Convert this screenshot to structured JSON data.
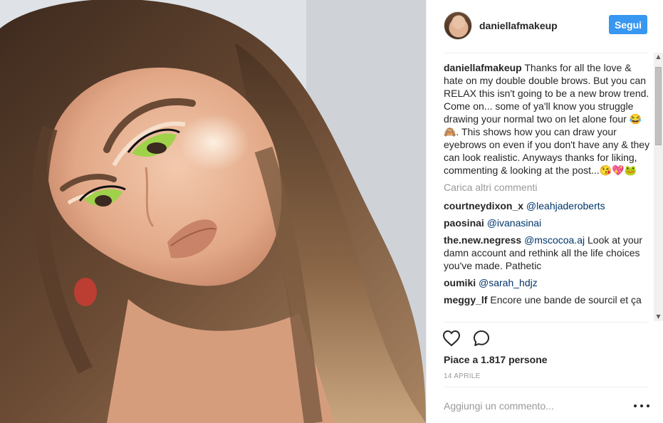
{
  "post": {
    "image_description_icon": "portrait-photo",
    "author": {
      "username": "daniellafmakeup",
      "follow_label": "Segui"
    },
    "caption": {
      "username": "daniellafmakeup",
      "text": "Thanks for all the love & hate on my double double brows. But you can RELAX this isn't going to be a new brow trend. Come on... some of ya'll know you struggle drawing your normal two on let alone four 😂🙈. This shows how you can draw your eyebrows on even if you don't have any & they can look realistic. Anyways thanks for liking, commenting & looking at the post...😘💖🐸"
    },
    "load_more_label": "Carica altri commenti",
    "comments": [
      {
        "username": "courtneydixon_x",
        "mention": "@leahjaderoberts",
        "text": ""
      },
      {
        "username": "paosinai",
        "mention": "@ivanasinai",
        "text": ""
      },
      {
        "username": "the.new.negress",
        "mention": "@mscocoa.aj",
        "text": " Look at your damn account and rethink all the life choices you've made. Pathetic"
      },
      {
        "username": "oumiki",
        "mention": "@sarah_hdjz",
        "text": ""
      },
      {
        "username": "meggy_lf",
        "mention": "",
        "text": "Encore une bande de sourcil et ça"
      }
    ],
    "likes_label": "Piace a 1.817 persone",
    "date_label": "14 APRILE",
    "add_comment_placeholder": "Aggiungi un commento...",
    "icons": {
      "like": "heart-icon",
      "comment": "comment-bubble-icon",
      "more": "more-options-icon"
    },
    "colors": {
      "follow_button": "#3897f0",
      "mention": "#003569",
      "muted": "#999999"
    }
  }
}
